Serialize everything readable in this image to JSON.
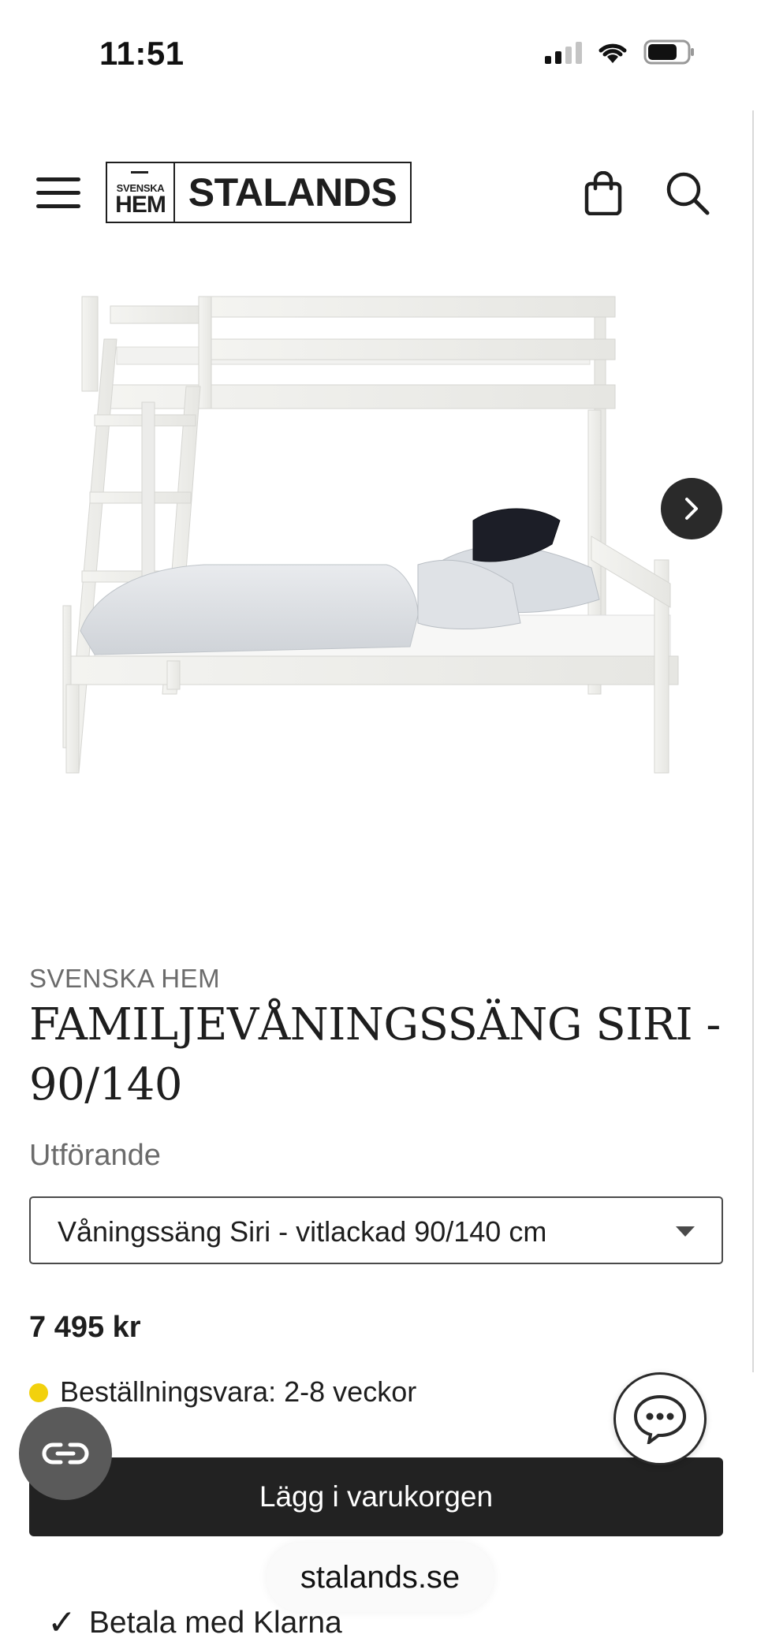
{
  "status_bar": {
    "time": "11:51"
  },
  "header": {
    "logo_small_top": "SVENSKA",
    "logo_small_bottom": "HEM",
    "logo_main": "STALANDS",
    "icons": [
      "menu-icon",
      "shopping-bag-icon",
      "search-icon"
    ]
  },
  "product": {
    "brand": "SVENSKA HEM",
    "title": "FAMILJEVÅNINGSSÄNG SIRI - 90/140",
    "variant_label": "Utförande",
    "variant_selected": "Våningssäng Siri - vitlackad 90/140 cm",
    "price": "7 495 kr",
    "stock_text": "Beställningsvara: 2-8 veckor",
    "stock_color": "#f2d10d",
    "add_to_cart": "Lägg i varukorgen",
    "payment_note": "Betala med Klarna"
  },
  "browser": {
    "url": "stalands.se"
  },
  "colors": {
    "accent_dark": "#222222",
    "muted_text": "#6b6b6b"
  }
}
